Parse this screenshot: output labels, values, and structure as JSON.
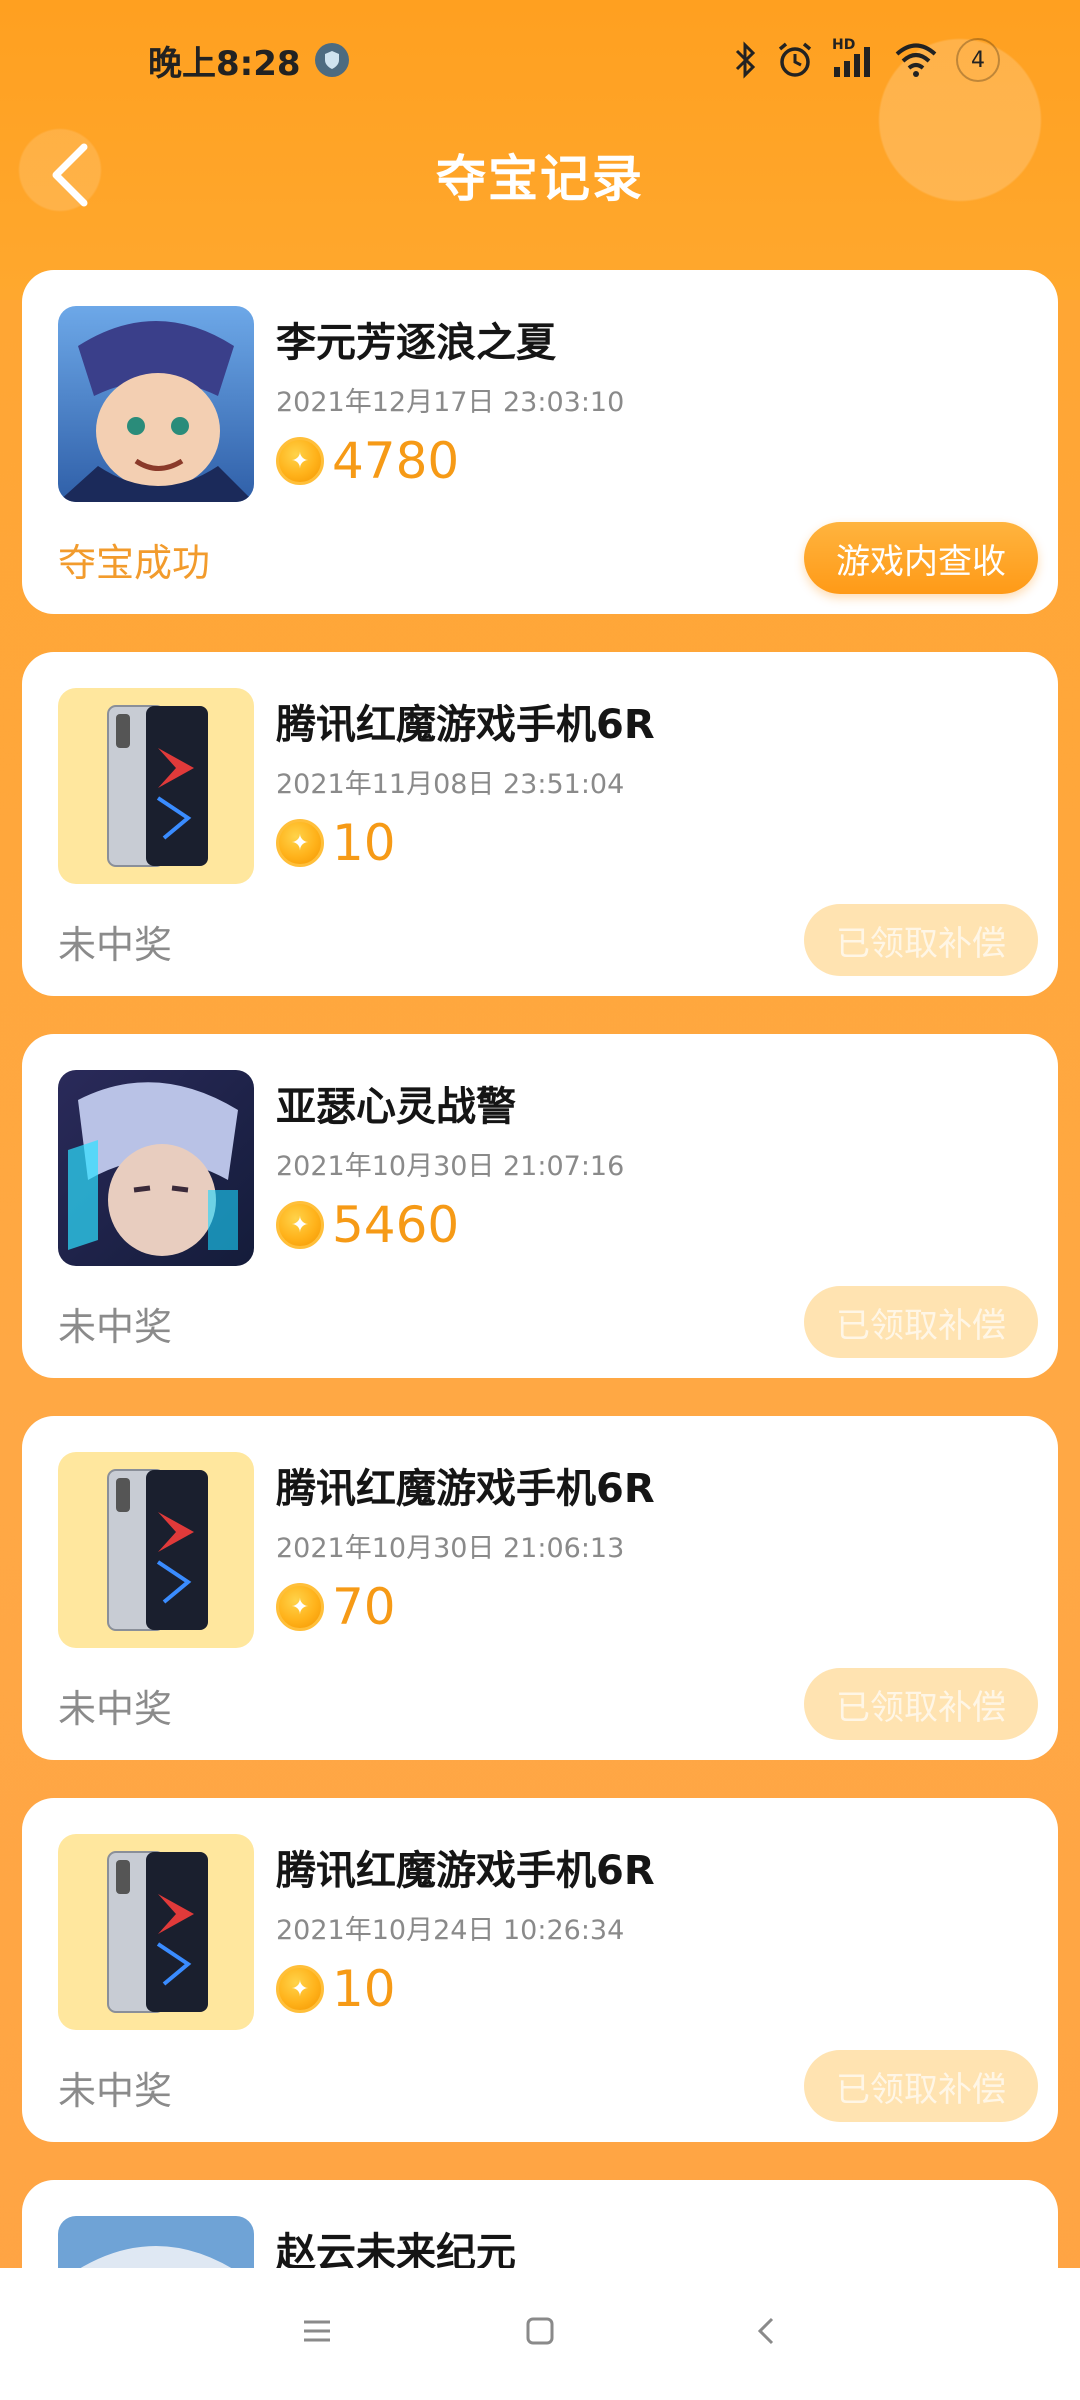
{
  "status_bar": {
    "time": "晚上8:28",
    "notification_count": "4",
    "network_label": "HD"
  },
  "header": {
    "title": "夺宝记录",
    "back_icon": "chevron-left-icon"
  },
  "colors": {
    "accent": "#ff9a17",
    "coin_amount": "#f69a16",
    "win_text": "#f29b2c",
    "lose_text": "#8b8b8b",
    "disabled_button": "#ffe3b1"
  },
  "records": [
    {
      "name": "李元芳逐浪之夏",
      "time": "2021年12月17日 23:03:10",
      "coins": "4780",
      "result": "夺宝成功",
      "button": "游戏内查收",
      "thumb": "hero-yuanfang-icon"
    },
    {
      "name": "腾讯红魔游戏手机6R",
      "time": "2021年11月08日 23:51:04",
      "coins": "10",
      "result": "未中奖",
      "button": "已领取补偿",
      "thumb": "phone-icon"
    },
    {
      "name": "亚瑟心灵战警",
      "time": "2021年10月30日 21:07:16",
      "coins": "5460",
      "result": "未中奖",
      "button": "已领取补偿",
      "thumb": "hero-arthur-icon"
    },
    {
      "name": "腾讯红魔游戏手机6R",
      "time": "2021年10月30日 21:06:13",
      "coins": "70",
      "result": "未中奖",
      "button": "已领取补偿",
      "thumb": "phone-icon"
    },
    {
      "name": "腾讯红魔游戏手机6R",
      "time": "2021年10月24日 10:26:34",
      "coins": "10",
      "result": "未中奖",
      "button": "已领取补偿",
      "thumb": "phone-icon"
    },
    {
      "name": "赵云未来纪元",
      "thumb": "hero-zhaoyun-icon"
    }
  ],
  "nav_bar": {
    "items": [
      "menu-icon",
      "home-icon",
      "back-icon"
    ]
  }
}
